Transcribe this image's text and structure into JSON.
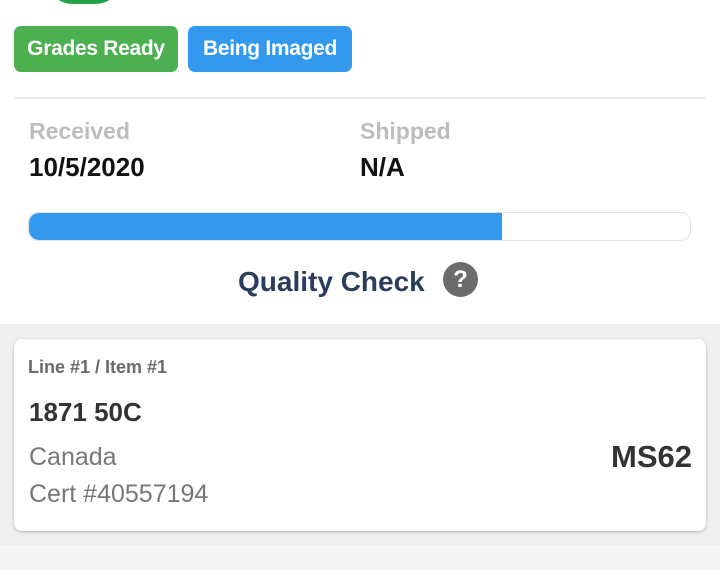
{
  "badges": [
    {
      "label": "Grades Ready",
      "color": "#4caf50"
    },
    {
      "label": "Being Imaged",
      "color": "#3399ee"
    }
  ],
  "order_info": {
    "received_label": "Received",
    "received_value": "10/5/2020",
    "shipped_label": "Shipped",
    "shipped_value": "N/A"
  },
  "progress": {
    "fraction": 0.716,
    "status_text": "Quality Check",
    "help_icon": "question-circle-icon",
    "fill_color": "#3399ee"
  },
  "item_card": {
    "line_item": "Line #1 / Item #1",
    "title": "1871 50C",
    "country": "Canada",
    "cert": "Cert #40557194",
    "grade": "MS62"
  },
  "colors": {
    "accent_green": "#4caf50",
    "accent_blue": "#3399ee",
    "status_text": "#2b3d5c"
  }
}
